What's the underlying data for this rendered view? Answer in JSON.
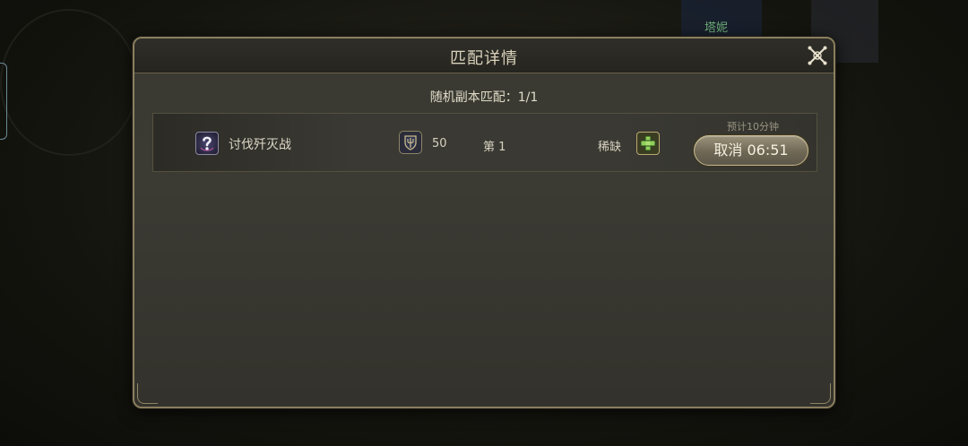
{
  "background": {
    "npc_name": "塔妮"
  },
  "dialog": {
    "title": "匹配详情",
    "close_icon": "close-x-icon",
    "summary_label": "随机副本匹配：",
    "summary_count": "1/1"
  },
  "queue_entry": {
    "dungeon_icon": "question-mark-icon",
    "dungeon_name": "讨伐歼灭战",
    "role_icon": "shield-trident-icon",
    "level": "50",
    "rank": "第 1",
    "role_status": "稀缺",
    "needed_role_icon": "green-cross-icon",
    "eta": "预计10分钟",
    "cancel_label": "取消 06:51"
  },
  "colors": {
    "panel_border": "#8a7e5e",
    "text_primary": "#dcd7c6",
    "npc_name": "#6fae7a",
    "healer_cross": "#8fcf5a"
  }
}
